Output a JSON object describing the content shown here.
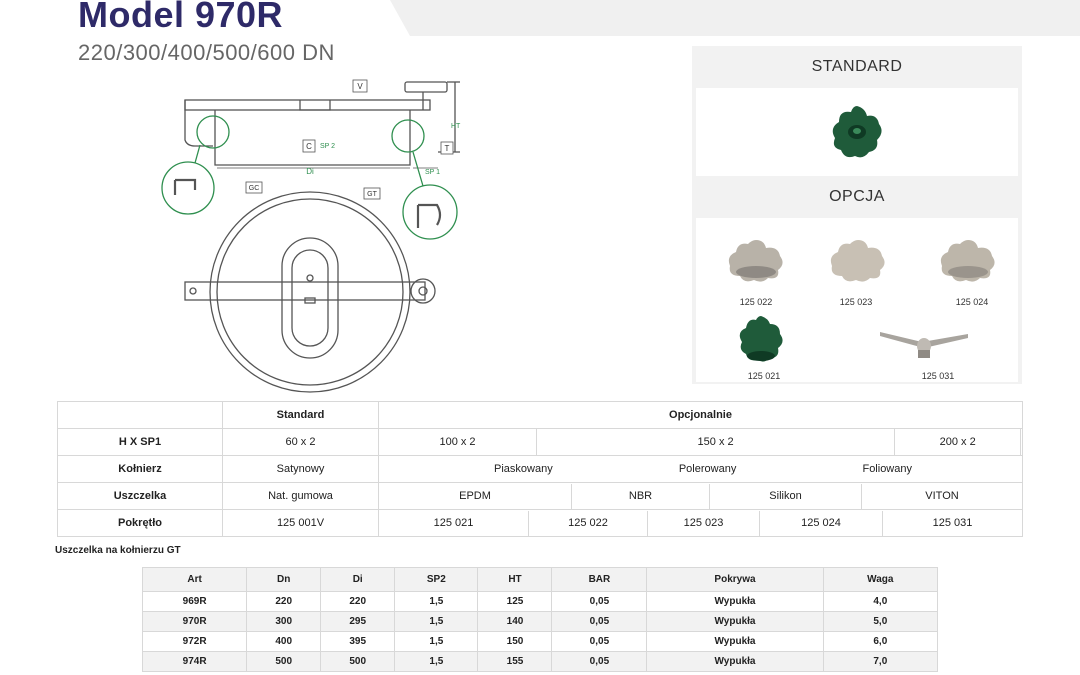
{
  "header": {
    "title": "Model 970R",
    "subtitle": "220/300/400/500/600 DN"
  },
  "drawing": {
    "labels": {
      "v": "V",
      "ht": "HT",
      "c": "C",
      "sp2": "SP 2",
      "t": "T",
      "di": "Di",
      "sp1": "SP 1",
      "gc": "GC",
      "gt": "GT"
    }
  },
  "panel": {
    "standard_title": "STANDARD",
    "option_title": "OPCJA",
    "codes": [
      "125 022",
      "125 023",
      "125 024",
      "125 021",
      "125 031"
    ],
    "colors": {
      "green": "#1f5b3a",
      "steel": "#b8b2a8"
    }
  },
  "spec": {
    "header": {
      "standard": "Standard",
      "optional": "Opcjonalnie"
    },
    "rows": [
      {
        "label": "H X SP1",
        "standard": "60 x 2",
        "options": [
          "100 x 2",
          "150 x 2",
          "200 x 2",
          ""
        ]
      },
      {
        "label": "Kołnierz",
        "standard": "Satynowy",
        "options": [
          "Piaskowany",
          "Polerowany",
          "Foliowany"
        ]
      },
      {
        "label": "Uszczelka",
        "standard": "Nat. gumowa",
        "options": [
          "EPDM",
          "NBR",
          "Silikon",
          "VITON"
        ]
      },
      {
        "label": "Pokrętło",
        "standard": "125 001V",
        "options": [
          "125 021",
          "125 022",
          "125 023",
          "125 024",
          "125 031"
        ]
      }
    ]
  },
  "note": "Uszczelka na kołnierzu GT",
  "dims": {
    "columns": [
      "Art",
      "Dn",
      "Di",
      "SP2",
      "HT",
      "BAR",
      "Pokrywa",
      "Waga"
    ],
    "rows": [
      [
        "969R",
        "220",
        "220",
        "1,5",
        "125",
        "0,05",
        "Wypukła",
        "4,0"
      ],
      [
        "970R",
        "300",
        "295",
        "1,5",
        "140",
        "0,05",
        "Wypukła",
        "5,0"
      ],
      [
        "972R",
        "400",
        "395",
        "1,5",
        "150",
        "0,05",
        "Wypukła",
        "6,0"
      ],
      [
        "974R",
        "500",
        "500",
        "1,5",
        "155",
        "0,05",
        "Wypukła",
        "7,0"
      ]
    ]
  }
}
